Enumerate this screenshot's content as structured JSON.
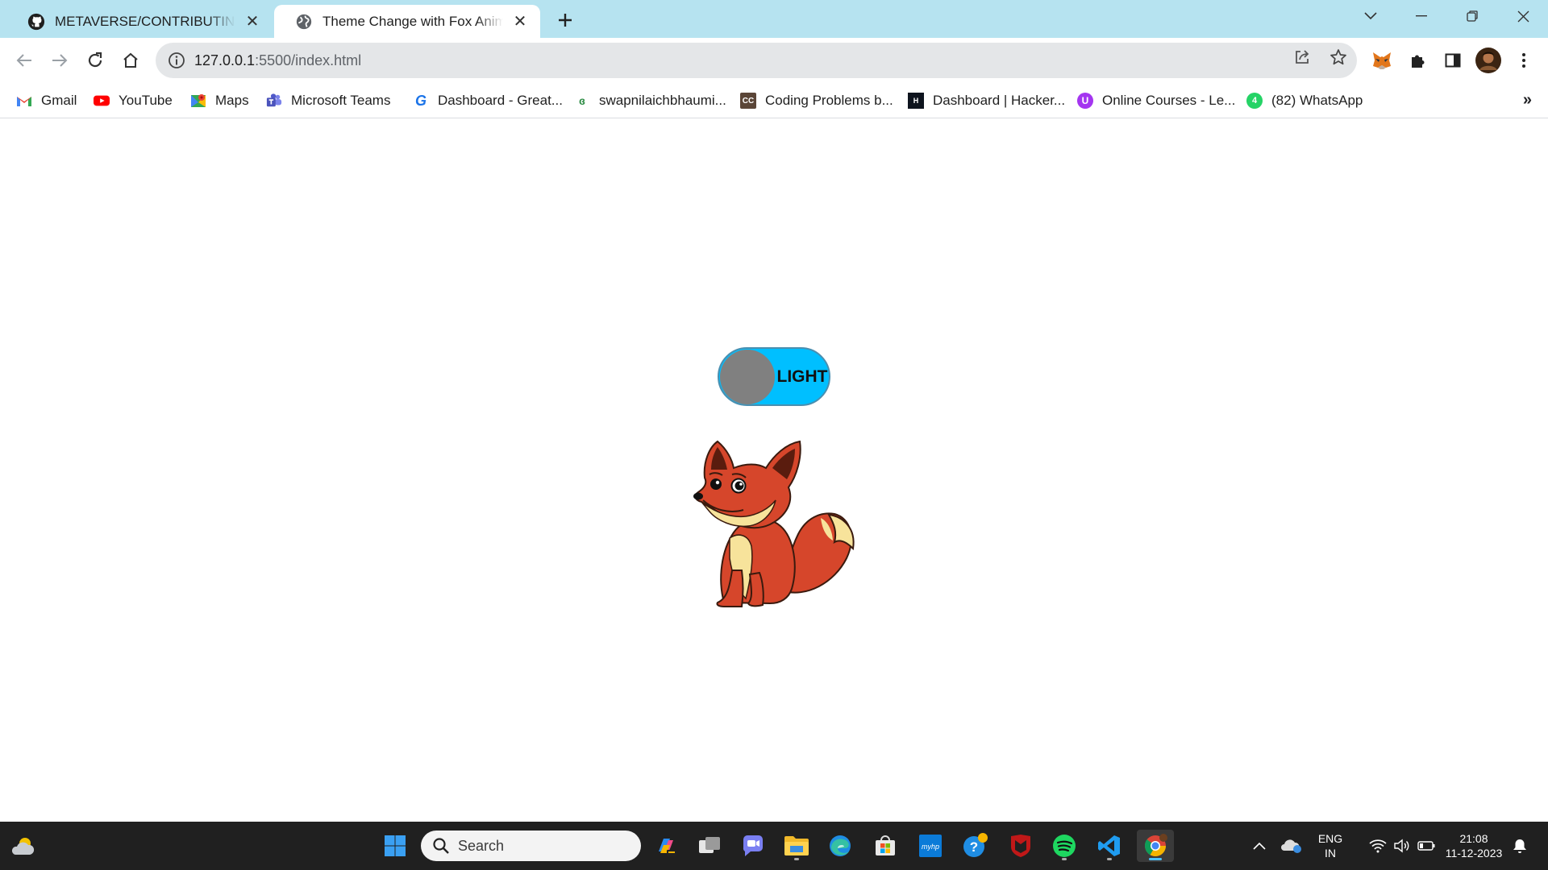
{
  "browser": {
    "tabs": [
      {
        "title": "METAVERSE/CONTRIBUTING.md",
        "icon": "github-icon",
        "active": false
      },
      {
        "title": "Theme Change with Fox Animation",
        "icon": "globe-icon",
        "active": true
      }
    ],
    "address": {
      "host": "127.0.0.1",
      "path": ":5500/index.html"
    },
    "bookmarks": [
      {
        "label": "Gmail",
        "icon": "gmail-icon"
      },
      {
        "label": "YouTube",
        "icon": "youtube-icon"
      },
      {
        "label": "Maps",
        "icon": "maps-icon"
      },
      {
        "label": "Microsoft Teams",
        "icon": "teams-icon"
      },
      {
        "label": "Dashboard - Great...",
        "icon": "google-icon"
      },
      {
        "label": "swapnilaichbhaumi...",
        "icon": "gfg-icon"
      },
      {
        "label": "Coding Problems b...",
        "icon": "codechef-icon"
      },
      {
        "label": "Dashboard | Hacker...",
        "icon": "hackerrank-icon"
      },
      {
        "label": "Online Courses - Le...",
        "icon": "udemy-icon"
      },
      {
        "label": "(82) WhatsApp",
        "icon": "whatsapp-icon"
      }
    ],
    "bookmarks_overflow": "»"
  },
  "page": {
    "toggle": {
      "label": "LIGHT",
      "state": "light",
      "track_color": "#00bfff",
      "knob_color": "#808080"
    },
    "illustration": "fox"
  },
  "taskbar": {
    "search_label": "Search",
    "tray": {
      "language": "ENG",
      "region": "IN",
      "time": "21:08",
      "date": "11-12-2023"
    }
  }
}
